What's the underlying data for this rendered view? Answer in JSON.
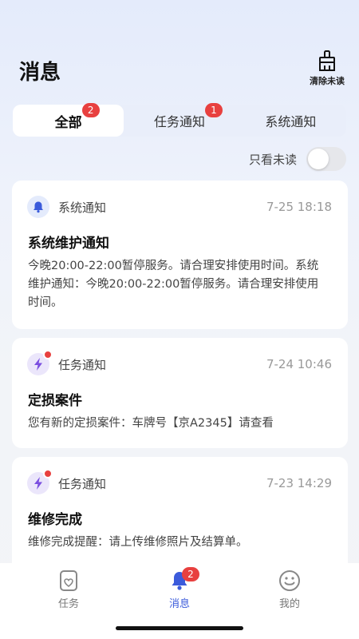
{
  "header": {
    "title": "消息",
    "clear_label": "清除未读"
  },
  "tabs": [
    {
      "label": "全部",
      "badge": "2",
      "active": true
    },
    {
      "label": "任务通知",
      "badge": "1",
      "active": false
    },
    {
      "label": "系统通知",
      "badge": "",
      "active": false
    }
  ],
  "filter": {
    "label": "只看未读",
    "enabled": false
  },
  "messages": [
    {
      "type": "系统通知",
      "icon": "bell-icon",
      "unread": false,
      "time": "7-25 18:18",
      "title": "系统维护通知",
      "body": "今晚20:00-22:00暂停服务。请合理安排使用时间。系统维护通知：今晚20:00-22:00暂停服务。请合理安排使用时间。"
    },
    {
      "type": "任务通知",
      "icon": "lightning-icon",
      "unread": true,
      "time": "7-24 10:46",
      "title": "定损案件",
      "body": "您有新的定损案件：车牌号【京A2345】请查看"
    },
    {
      "type": "任务通知",
      "icon": "lightning-icon",
      "unread": true,
      "time": "7-23 14:29",
      "title": "维修完成",
      "body": "维修完成提醒：请上传维修照片及结算单。"
    }
  ],
  "bottom_nav": [
    {
      "label": "任务",
      "icon": "task-icon",
      "active": false
    },
    {
      "label": "消息",
      "icon": "bell-icon",
      "active": true,
      "badge": "2"
    },
    {
      "label": "我的",
      "icon": "smiley-icon",
      "active": false
    }
  ],
  "colors": {
    "accent": "#3b5bdb",
    "badge": "#e8403f",
    "task_icon": "#7b4fe0"
  }
}
